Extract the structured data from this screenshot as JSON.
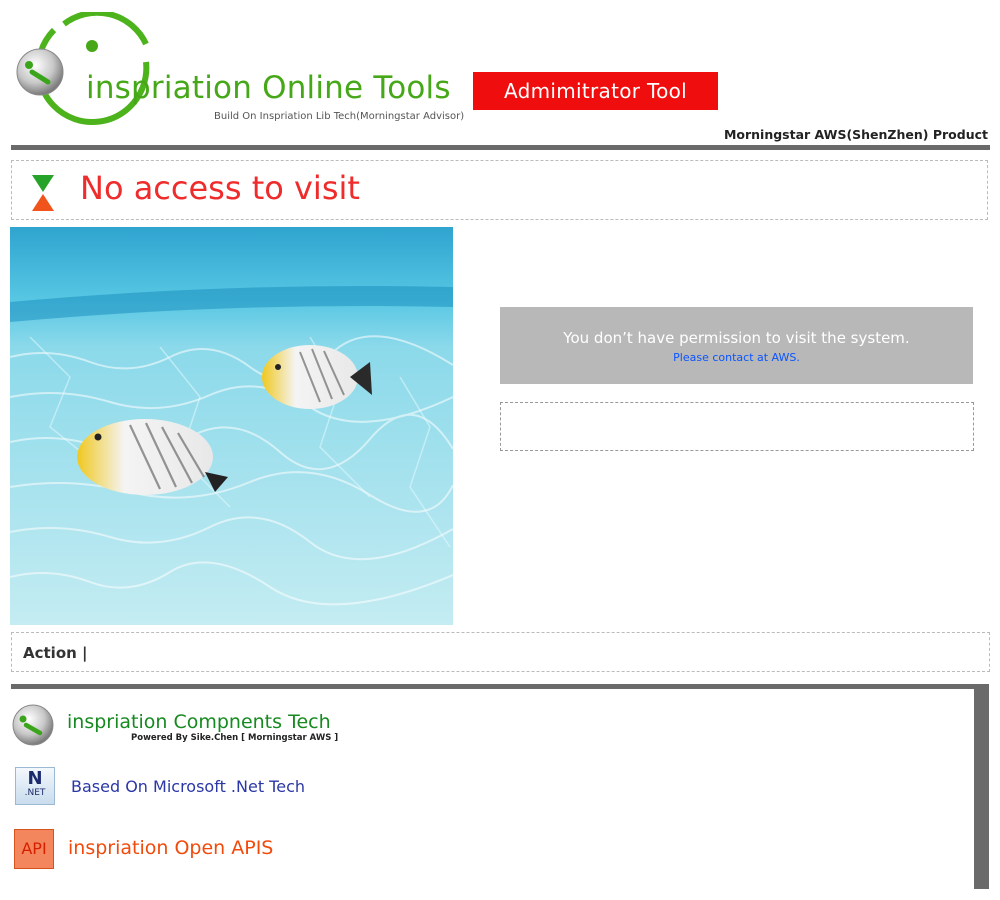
{
  "header": {
    "brand_i": "i",
    "brand_rest": "nspriation Online Tools",
    "brand_subtitle": "Build On Inspriation Lib Tech(Morningstar Advisor)",
    "admin_badge": "Admimitrator Tool",
    "product_text": "Morningstar AWS(ShenZhen) Product"
  },
  "notice": {
    "title": "No access to visit",
    "message": "You don’t have permission to visit the system.",
    "contact_link": "Please contact at AWS."
  },
  "action_bar": {
    "label": "Action |"
  },
  "footer": {
    "items": [
      {
        "title": "inspriation Compnents Tech",
        "subtitle": "Powered By Sike.Chen [ Morningstar AWS ]",
        "icon": "inspiration-logo-icon"
      },
      {
        "title": "Based On Microsoft .Net Tech",
        "icon": "dotnet-icon",
        "icon_text_n": "N",
        "icon_text_label": ".NET"
      },
      {
        "title": "inspriation Open APIS",
        "icon": "api-icon",
        "icon_text": "API"
      }
    ]
  },
  "colors": {
    "brand_green": "#46a818",
    "admin_red": "#f00d0d",
    "alert_red": "#ef2b2b",
    "rule_gray": "#6a6a6a",
    "message_gray": "#b8b8b8",
    "link_blue": "#0a55ff"
  }
}
